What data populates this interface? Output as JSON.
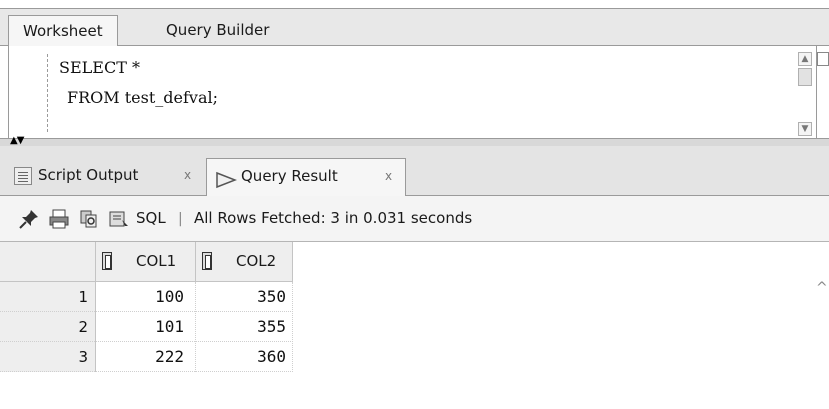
{
  "worksheet_tabs": {
    "active": "Worksheet",
    "inactive": "Query Builder"
  },
  "editor": {
    "line1": "SELECT *",
    "line2": "FROM test_defval;"
  },
  "output_tabs": {
    "script_output": "Script Output",
    "script_output_close": "x",
    "query_result": "Query Result",
    "query_result_close": "x"
  },
  "toolbar": {
    "sql_label": "SQL",
    "separator": "|",
    "status": "All Rows Fetched: 3 in 0.031 seconds"
  },
  "grid": {
    "columns": [
      "COL1",
      "COL2"
    ],
    "rows": [
      {
        "num": "1",
        "col1": "100",
        "col2": "350"
      },
      {
        "num": "2",
        "col1": "101",
        "col2": "355"
      },
      {
        "num": "3",
        "col1": "222",
        "col2": "360"
      }
    ]
  },
  "icons": {
    "pin": "pin-icon",
    "print": "print-icon",
    "refresh": "refresh-query-icon",
    "sql_edit": "sql-icon",
    "script_output": "script-output-icon",
    "query_result": "query-result-icon",
    "column_pin": "column-header-pin-icon"
  }
}
